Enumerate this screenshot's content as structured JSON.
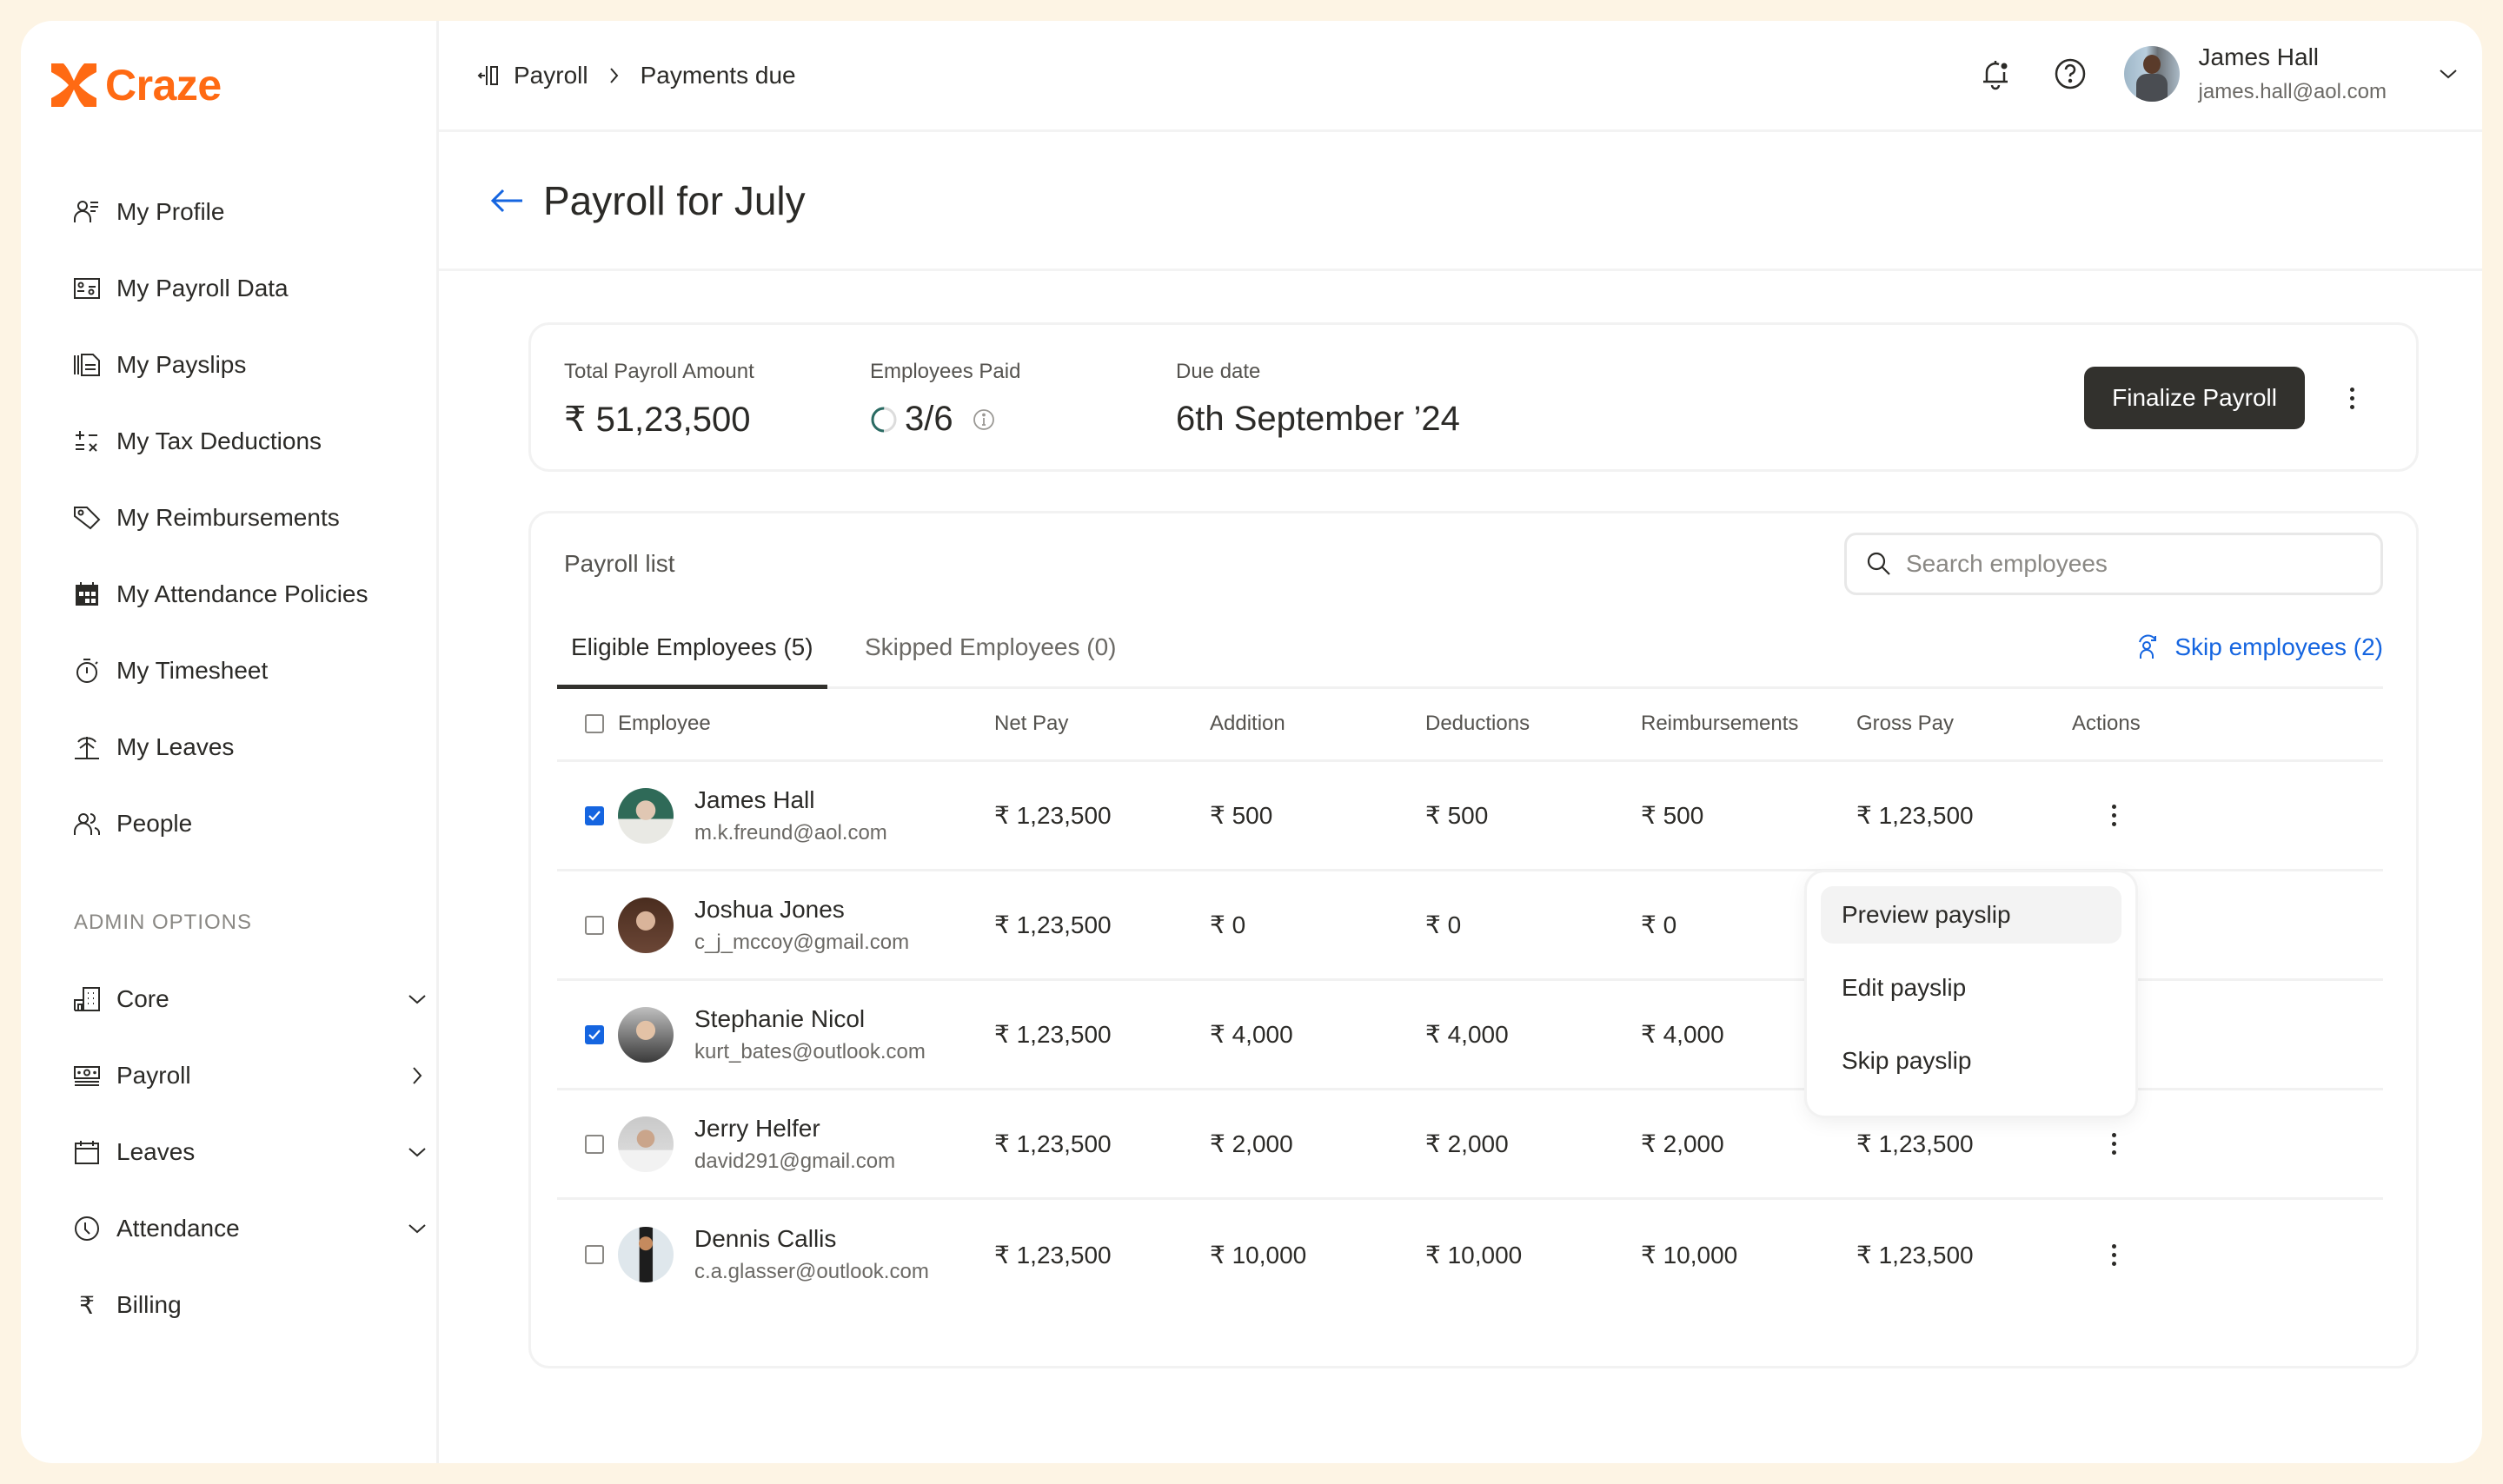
{
  "brand": {
    "name": "Craze",
    "color": "#ff6a13"
  },
  "sidebar": {
    "items": [
      {
        "label": "My Profile",
        "icon": "profile-icon"
      },
      {
        "label": "My Payroll Data",
        "icon": "id-card-icon"
      },
      {
        "label": "My Payslips",
        "icon": "payslips-icon"
      },
      {
        "label": "My Tax Deductions",
        "icon": "calculator-icon"
      },
      {
        "label": "My Reimbursements",
        "icon": "tag-icon"
      },
      {
        "label": "My Attendance Policies",
        "icon": "calendar-grid-icon"
      },
      {
        "label": "My Timesheet",
        "icon": "stopwatch-icon"
      },
      {
        "label": "My Leaves",
        "icon": "palm-tree-icon"
      },
      {
        "label": "People",
        "icon": "people-icon"
      }
    ],
    "admin_label": "ADMIN OPTIONS",
    "admin_items": [
      {
        "label": "Core",
        "icon": "building-icon",
        "chevron": "down"
      },
      {
        "label": "Payroll",
        "icon": "money-icon",
        "chevron": "right"
      },
      {
        "label": "Leaves",
        "icon": "calendar-icon",
        "chevron": "down"
      },
      {
        "label": "Attendance",
        "icon": "clock-icon",
        "chevron": "down"
      },
      {
        "label": "Billing",
        "icon": "rupee-icon",
        "chevron": null
      }
    ]
  },
  "header": {
    "breadcrumb": [
      "Payroll",
      "Payments due"
    ],
    "user": {
      "name": "James Hall",
      "email": "james.hall@aol.com"
    }
  },
  "page": {
    "title": "Payroll for July"
  },
  "summary": {
    "total_label": "Total Payroll Amount",
    "total_value": "₹ 51,23,500",
    "paid_label": "Employees Paid",
    "paid_value": "3/6",
    "paid_progress": 0.5,
    "due_label": "Due date",
    "due_value": "6th September ’24",
    "finalize_label": "Finalize Payroll"
  },
  "list": {
    "title": "Payroll list",
    "search_placeholder": "Search employees",
    "tabs": [
      {
        "label": "Eligible Employees (5)",
        "active": true
      },
      {
        "label": "Skipped Employees (0)",
        "active": false
      }
    ],
    "skip_label": "Skip employees (2)",
    "accent": "#1565e0",
    "columns": [
      "Employee",
      "Net Pay",
      "Addition",
      "Deductions",
      "Reimbursements",
      "Gross Pay",
      "Actions"
    ],
    "rows": [
      {
        "checked": true,
        "name": "James Hall",
        "email": "m.k.freund@aol.com",
        "net": "₹ 1,23,500",
        "add": "₹ 500",
        "ded": "₹ 500",
        "rei": "₹ 500",
        "gross": "₹ 1,23,500"
      },
      {
        "checked": false,
        "name": "Joshua Jones",
        "email": "c_j_mccoy@gmail.com",
        "net": "₹ 1,23,500",
        "add": "₹ 0",
        "ded": "₹ 0",
        "rei": "₹ 0",
        "gross": ""
      },
      {
        "checked": true,
        "name": "Stephanie Nicol",
        "email": "kurt_bates@outlook.com",
        "net": "₹ 1,23,500",
        "add": "₹ 4,000",
        "ded": "₹ 4,000",
        "rei": "₹ 4,000",
        "gross": ""
      },
      {
        "checked": false,
        "name": "Jerry Helfer",
        "email": "david291@gmail.com",
        "net": "₹ 1,23,500",
        "add": "₹ 2,000",
        "ded": "₹ 2,000",
        "rei": "₹ 2,000",
        "gross": "₹ 1,23,500"
      },
      {
        "checked": false,
        "name": "Dennis Callis",
        "email": "c.a.glasser@outlook.com",
        "net": "₹ 1,23,500",
        "add": "₹ 10,000",
        "ded": "₹ 10,000",
        "rei": "₹ 10,000",
        "gross": "₹ 1,23,500"
      }
    ]
  },
  "action_menu": {
    "items": [
      "Preview payslip",
      "Edit payslip",
      "Skip payslip"
    ],
    "highlighted": 0
  }
}
